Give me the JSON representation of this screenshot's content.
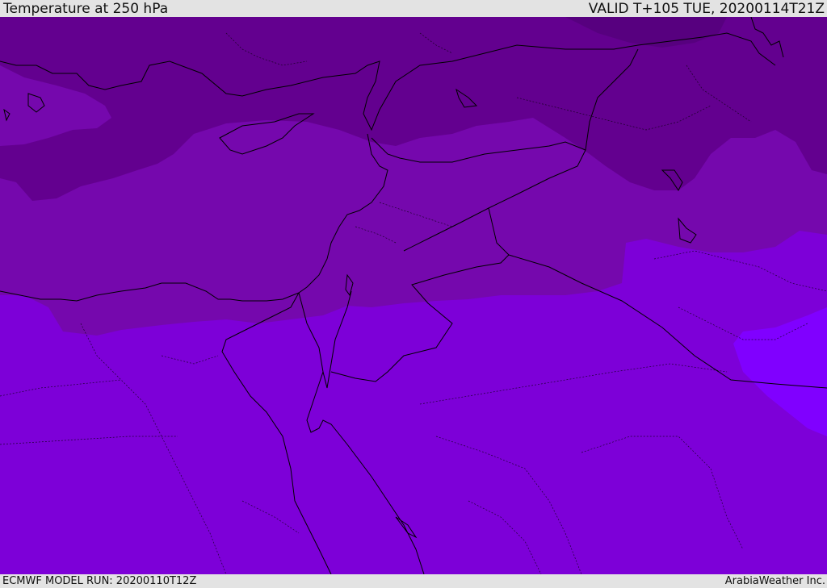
{
  "header": {
    "title": "Temperature at 250 hPa",
    "valid": "VALID T+105 TUE, 20200114T21Z"
  },
  "footer": {
    "model_run": "ECMWF MODEL RUN: 20200110T12Z",
    "credit": "ArabiaWeather Inc."
  },
  "colors": {
    "band_coldest": "#57007f",
    "band_cold": "#63008f",
    "band_mid": "#7508ad",
    "band_main": "#7d00d8",
    "band_warm": "#8000ff",
    "coastline": "#000000",
    "border": "#000000",
    "background": "#e3e3e3"
  }
}
